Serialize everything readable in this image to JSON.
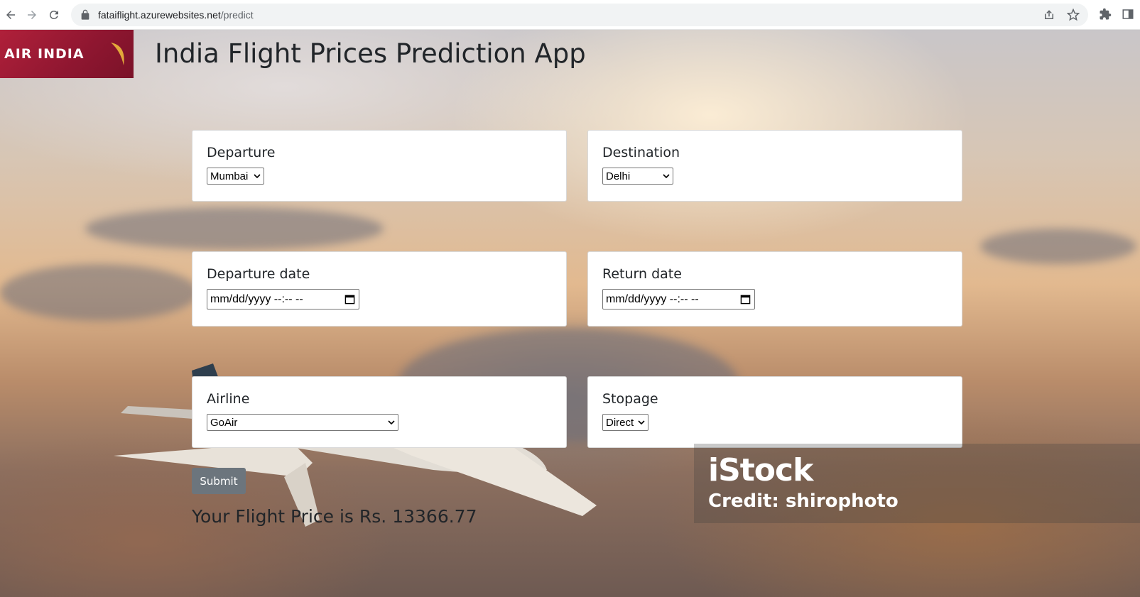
{
  "browser": {
    "url_host": "fataiflight.azurewebsites.net",
    "url_path": "/predict"
  },
  "header": {
    "logo_text": "AIR INDIA",
    "title": "India Flight Prices Prediction App"
  },
  "form": {
    "departure": {
      "label": "Departure",
      "value": "Mumbai"
    },
    "destination": {
      "label": "Destination",
      "value": "Delhi"
    },
    "departure_date": {
      "label": "Departure date",
      "value": "mm/dd/yyyy --:-- --"
    },
    "return_date": {
      "label": "Return date",
      "value": "mm/dd/yyyy --:-- --"
    },
    "airline": {
      "label": "Airline",
      "value": "GoAir"
    },
    "stopage": {
      "label": "Stopage",
      "value": "Direct"
    },
    "submit_label": "Submit"
  },
  "result": {
    "text": "Your Flight Price is Rs. 13366.77"
  },
  "watermark": {
    "brand": "iStock",
    "credit": "Credit: shirophoto"
  },
  "colors": {
    "brand_red": "#9a1a33",
    "button_gray": "#6c757d",
    "text_dark": "#212529"
  },
  "icons": [
    "back-arrow-icon",
    "forward-arrow-icon",
    "reload-icon",
    "lock-icon",
    "share-icon",
    "star-icon",
    "extensions-icon",
    "sidebar-icon",
    "chevron-down-icon",
    "calendar-icon"
  ]
}
